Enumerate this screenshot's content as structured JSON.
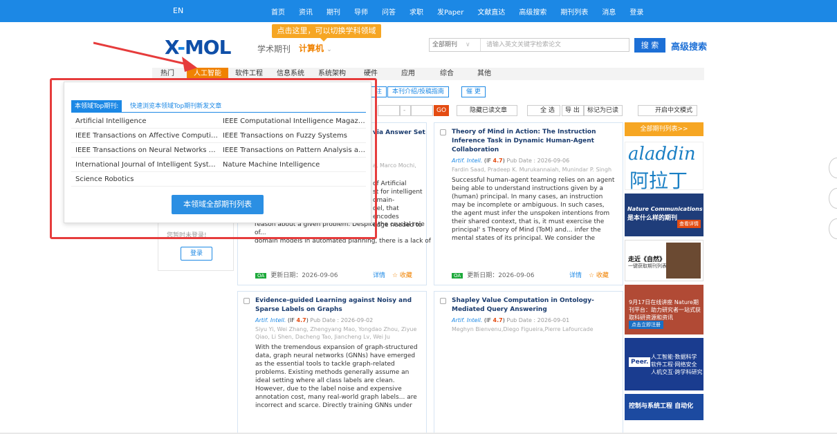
{
  "topbar": {
    "lang": "EN",
    "nav": [
      "首页",
      "资讯",
      "期刊",
      "导师",
      "问答",
      "求职",
      "发Paper",
      "文献直达",
      "高级搜索",
      "期刊列表",
      "消息",
      "登录"
    ]
  },
  "tooltip": "点击这里，可以切换学科领域",
  "logo": {
    "brand_left": "X",
    "brand_dash": "-",
    "brand_right": "MOL",
    "sub": "学术期刊",
    "field": "计算机",
    "field_chevron": "⌄"
  },
  "search": {
    "scope": "全部期刊",
    "scope_chevron": "∨",
    "placeholder": "请输入英文关键字检索论文",
    "button": "搜 索",
    "advanced": "高级搜索"
  },
  "categories": [
    "热门",
    "人工智能",
    "软件工程",
    "信息系统",
    "系统架构",
    "硬件",
    "应用",
    "综合",
    "其他"
  ],
  "panel": {
    "tab_active": "本领域Top期刊:",
    "tab_link": "快速浏览本领域Top期刊新发文章",
    "journals": [
      [
        "Artificial Intelligence",
        "IEEE Computational Intelligence Magazine"
      ],
      [
        "IEEE Transactions on Affective Computing",
        "IEEE Transactions on Fuzzy Systems"
      ],
      [
        "IEEE Transactions on Neural Networks and...",
        "IEEE Transactions on Pattern Analysis and ..."
      ],
      [
        "International Journal of Intelligent Systems",
        "Nature Machine Intelligence"
      ],
      [
        "Science Robotics",
        ""
      ]
    ],
    "all_button": "本领域全部期刊列表"
  },
  "controls": {
    "pill1": "本刊介绍/投稿指南",
    "pill2": "催 更",
    "pill0": "注",
    "go": "GO",
    "dash": "-",
    "hide_read": "隐藏已读文章",
    "select_all": "全 选",
    "export": "导 出",
    "mark_read": "标记为已读",
    "chinese_mode": "开启中文模式"
  },
  "sidebar": {
    "notice": "您暂时未登录!",
    "login": "登录"
  },
  "articles": [
    {
      "title": "Theory of Mind in Action: The Instruction Inference Task in Dynamic Human-Agent Collaboration",
      "journal": "Artif. Intell.",
      "if_label": "(IF",
      "if_value": "4.7",
      "if_close": ")",
      "pub": "Pub Date : 2026-09-06",
      "authors": "Fardin Saad, Pradeep K. Murukannaiah, Munindar P. Singh",
      "abstract": "Successful human-agent teaming relies on an agent being able to understand instructions given by a (human) principal. In many cases, an instruction may be incomplete or ambiguous. In such cases, the agent must infer the unspoken intentions from their shared context, that is, it must exercise the principal' s Theory of Mind (ToM) and... infer the mental states of its principal. We consider the",
      "oa": "OA",
      "updated": "更新日期：2026-09-06",
      "details": "详情",
      "favorite": "☆ 收藏"
    },
    {
      "title": "Evidence-guided Learning against Noisy and Sparse Labels on Graphs",
      "journal": "Artif. Intell.",
      "if_label": "(IF",
      "if_value": "4.7",
      "if_close": ")",
      "pub": "Pub Date : 2026-09-02",
      "authors": "Siyu Yi, Wei Zhang, Zhengyang Mao, Yongdao Zhou, Ziyue Qiao, Li Shen, Dacheng Tao, Jiancheng Lv, Wei Ju",
      "abstract": "With the tremendous expansion of graph-structured data, graph neural networks (GNNs) have emerged as the essential tools to tackle graph-related problems. Existing methods generally assume an ideal setting where all class labels are clean. However, due to the label noise and expensive annotation cost, many real-world graph labels... are incorrect and scarce. Directly training GNNs under such"
    },
    {
      "title": "Shapley Value Computation in Ontology-Mediated Query Answering",
      "journal": "Artif. Intell.",
      "if_label": "(IF",
      "if_value": "4.7",
      "if_close": ")",
      "pub": "Pub Date : 2026-09-01",
      "authors": "Meghyn Bienvenu,Diego Figueira,Pierre Lafourcade"
    }
  ],
  "first_card": {
    "title_tail": "via Answer Set",
    "authors_tail": "a, Marco Mochi,",
    "abs_lines": [
      "of Artificial",
      "st for intelligent",
      "omain-",
      "del, that encodes",
      "edge needed to"
    ],
    "abs_full1": "reason about a given problem. Despite the crucial role of...",
    "abs_full2": "domain models in automated planning, there is a lack of",
    "oa": "OA",
    "updated": "更新日期：2026-09-06",
    "details": "详情",
    "favorite": "☆ 收藏"
  },
  "right": {
    "button": "全部期刊列表>>",
    "ad1_en": "aladdin",
    "ad1_cn": "阿拉丁",
    "ad2_title": "Nature Communications",
    "ad2_sub": "是本什么样的期刊",
    "ad2_btn": "查看详情",
    "ad3_title": "走近《自然》",
    "ad3_sub": "一键获取期刊列表",
    "ad4_text": "9月17日在线讲座 Nature期刊平台：助力研究者一站式获取科研资源和资讯",
    "ad4_btn": "点击立即注册",
    "ad5_badge": "Peer.",
    "ad5_text": "人工智能·数据科学 软件工程·网络安全 人机交互·跨学科研究",
    "ad6_text": "控制与系统工程 自动化"
  },
  "colors": {
    "accent": "#1c88e5",
    "orange": "#f08200",
    "red_box": "#e63c3c"
  }
}
